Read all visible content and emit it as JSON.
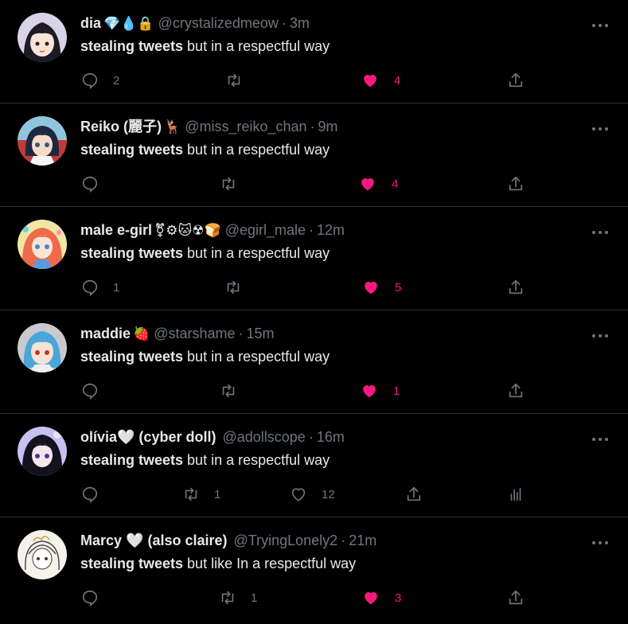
{
  "colors": {
    "background": "#000000",
    "text": "#e7e9ea",
    "muted": "#71767b",
    "like_pink": "#f91880",
    "divider": "#2f3336"
  },
  "icons": {
    "more": "more-horizontal-icon",
    "reply": "reply-icon",
    "retweet": "retweet-icon",
    "like": "heart-icon",
    "share": "share-icon",
    "views": "analytics-icon"
  },
  "tweets": [
    {
      "display_name": "dia",
      "name_emojis": "💎💧🔒",
      "handle": "@crystalizedmeow",
      "separator": "·",
      "time": "3m",
      "text_bold": "stealing tweets",
      "text_rest": " but in a respectful way",
      "reply_count": "2",
      "retweet_count": "",
      "like_count": "4",
      "liked": true
    },
    {
      "display_name": "Reiko (麗子)",
      "name_emojis": "🦌",
      "handle": "@miss_reiko_chan",
      "separator": "·",
      "time": "9m",
      "text_bold": "stealing tweets",
      "text_rest": " but in a respectful way",
      "reply_count": "",
      "retweet_count": "",
      "like_count": "4",
      "liked": true
    },
    {
      "display_name": "male e-girl",
      "name_emojis": "⚧⚙🐱☢🍞",
      "handle": "@egirl_male",
      "separator": "·",
      "time": "12m",
      "text_bold": "stealing tweets",
      "text_rest": " but in a respectful way",
      "reply_count": "1",
      "retweet_count": "",
      "like_count": "5",
      "liked": true
    },
    {
      "display_name": "maddie",
      "name_emojis": "🍓",
      "handle": "@starshame",
      "separator": "·",
      "time": "15m",
      "text_bold": "stealing tweets",
      "text_rest": " but in a respectful way",
      "reply_count": "",
      "retweet_count": "",
      "like_count": "1",
      "liked": true
    },
    {
      "display_name": "olívia🤍 (cyber doll)",
      "name_emojis": "",
      "handle": "@adollscope",
      "separator": "·",
      "time": "16m",
      "text_bold": "stealing tweets",
      "text_rest": " but in a respectful way",
      "reply_count": "",
      "retweet_count": "1",
      "like_count": "12",
      "liked": false
    },
    {
      "display_name": "Marcy 🤍 (also claire)",
      "name_emojis": "",
      "handle": "@TryingLonely2",
      "separator": "·",
      "time": "21m",
      "text_bold": "stealing tweets",
      "text_rest": " but like In a respectful way",
      "reply_count": "",
      "retweet_count": "1",
      "like_count": "3",
      "liked": true
    }
  ]
}
